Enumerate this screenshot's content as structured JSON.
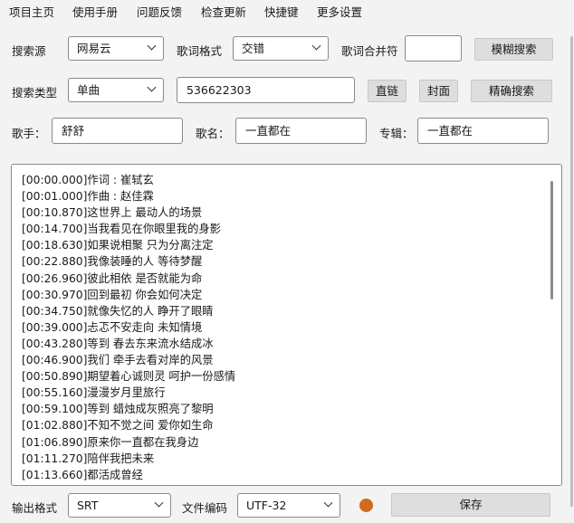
{
  "menu": [
    "项目主页",
    "使用手册",
    "问题反馈",
    "检查更新",
    "快捷键",
    "更多设置"
  ],
  "row1": {
    "source_label": "搜索源",
    "source_value": "网易云",
    "format_label": "歌词格式",
    "format_value": "交错",
    "merge_label": "歌词合并符",
    "merge_value": "",
    "fuzzy_button": "模糊搜索"
  },
  "row2": {
    "type_label": "搜索类型",
    "type_value": "单曲",
    "id_value": "536622303",
    "link_button": "直链",
    "cover_button": "封面",
    "exact_button": "精确搜索"
  },
  "row3": {
    "singer_label": "歌手：",
    "singer_value": "舒舒",
    "song_label": "歌名：",
    "song_value": "一直都在",
    "album_label": "专辑：",
    "album_value": "一直都在"
  },
  "lyrics": [
    "[00:00.000]作词 : 崔轼玄",
    "[00:01.000]作曲 : 赵佳霖",
    "[00:10.870]这世界上 最动人的场景",
    "[00:14.700]当我看见在你眼里我的身影",
    "[00:18.630]如果说相聚 只为分离注定",
    "[00:22.880]我像装睡的人 等待梦醒",
    "[00:26.960]彼此相依 是否就能为命",
    "[00:30.970]回到最初 你会如何决定",
    "[00:34.750]就像失忆的人 睁开了眼睛",
    "[00:39.000]忐忑不安走向 未知情境",
    "[00:43.280]等到 春去东来流水结成冰",
    "[00:46.900]我们 牵手去看对岸的风景",
    "[00:50.890]期望着心诚则灵 呵护一份感情",
    "[00:55.160]漫漫岁月里旅行",
    "[00:59.100]等到 蜡烛成灰照亮了黎明",
    "[01:02.880]不知不觉之间 爱你如生命",
    "[01:06.890]原来你一直都在我身边",
    "[01:11.270]陪伴我把未来",
    "[01:13.660]都活成曾经"
  ],
  "bottom": {
    "output_label": "输出格式",
    "output_value": "SRT",
    "encoding_label": "文件编码",
    "encoding_value": "UTF-32",
    "save_button": "保存"
  },
  "colors": {
    "status_dot": "#d06a1c",
    "button_bg": "#dedede"
  }
}
